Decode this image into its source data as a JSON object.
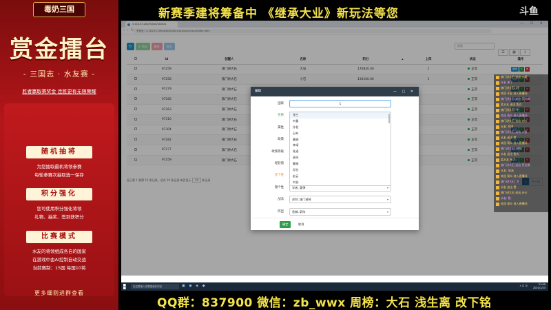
{
  "promo": {
    "tag": "毒奶三国",
    "headline": "赏金擂台",
    "subtitle": "- 三国志 · 水友赛 -",
    "slogan": "胜者赢取赛奖金  连胜更有无限荣耀",
    "sections": [
      {
        "title": "随机抽将",
        "lines": [
          "为您抽取最机将领参赛",
          "每轮参赛次抽取选一保存"
        ]
      },
      {
        "title": "积分强化",
        "lines": [
          "您可使用积分强化将领",
          "礼物、抽奖、签到获积分"
        ]
      },
      {
        "title": "比赛模式",
        "lines": [
          "水友的将领组成各自的国家",
          "在游戏中由AI控制自动交战",
          "当前赛制：15国  每国10将"
        ]
      }
    ],
    "footer": "更多细则进群查看"
  },
  "banner": {
    "text": "新赛季建将筹备中  《继承大业》新玩法等您",
    "logo": "斗鱼"
  },
  "browser": {
    "tab_title": "3.116.33.200/9x0x0/40x0x1",
    "address": "不安全 | 3.116.33.200/dxb/x0/40x1/xxx/xxxx/xxxx/index.html"
  },
  "toolbar": {
    "refresh_icon": "refresh-icon",
    "add_label": "+ 添加",
    "delete_label": "删除",
    "edit_label": "修改",
    "search_placeholder": "搜索"
  },
  "table": {
    "headers": [
      "",
      "id",
      "创建人",
      "名称",
      "积分",
      "",
      "上阵",
      "状态",
      "操作"
    ],
    "rows": [
      {
        "id": "97259",
        "creator": "旗门讲大石",
        "name": "大石",
        "score": "176820.00",
        "deploy": "1",
        "status": "正常"
      },
      {
        "id": "97258",
        "creator": "旗门讲大石",
        "name": "小石",
        "score": "134100.00",
        "deploy": "1",
        "status": "正常"
      },
      {
        "id": "97279",
        "creator": "旗门讲大石",
        "name": "",
        "score": "",
        "deploy": "",
        "status": "正常"
      },
      {
        "id": "97266",
        "creator": "旗门讲大石",
        "name": "",
        "score": "",
        "deploy": "",
        "status": "正常"
      },
      {
        "id": "97263",
        "creator": "旗门讲大石",
        "name": "",
        "score": "",
        "deploy": "",
        "status": "正常"
      },
      {
        "id": "97310",
        "creator": "旗门讲大石",
        "name": "",
        "score": "",
        "deploy": "",
        "status": "正常"
      },
      {
        "id": "97304",
        "creator": "旗门讲大石",
        "name": "",
        "score": "",
        "deploy": "",
        "status": "正常"
      },
      {
        "id": "97281",
        "creator": "旗门讲大石",
        "name": "",
        "score": "",
        "deploy": "",
        "status": "正常"
      },
      {
        "id": "97277",
        "creator": "旗门讲大石",
        "name": "",
        "score": "",
        "deploy": "",
        "status": "正常"
      },
      {
        "id": "97259",
        "creator": "旗门讲大石",
        "name": "",
        "score": "",
        "deploy": "",
        "status": "正常"
      }
    ],
    "op_labels": [
      "编辑",
      "✎",
      "✖"
    ]
  },
  "pager": {
    "summary": "显示第 1 到第 10 条记录，总共 10 条记录 每页显示",
    "page_size": "10",
    "suffix": "条记录",
    "prev": "上一页",
    "current": "1",
    "next": "下一页"
  },
  "modal": {
    "title": "编辑",
    "fields": [
      {
        "label": "国家",
        "value": "1",
        "style": "",
        "kind": "input"
      },
      {
        "label": "名称",
        "value": "",
        "style": "green",
        "kind": "none"
      },
      {
        "label": "属性",
        "value": "",
        "style": "",
        "kind": "none"
      },
      {
        "label": "政策",
        "value": "",
        "style": "",
        "kind": "none"
      },
      {
        "label": "政策等级",
        "value": "",
        "style": "",
        "kind": "none"
      },
      {
        "label": "经验值",
        "value": "",
        "style": "",
        "kind": "none"
      },
      {
        "label": "金个性",
        "value": "",
        "style": "orange",
        "kind": "none"
      },
      {
        "label": "银个性",
        "value": "学者, 重弹",
        "style": "",
        "kind": "select"
      },
      {
        "label": "战法",
        "value": "虎狩, 旗门城琴",
        "style": "",
        "kind": "select"
      },
      {
        "label": "阵型",
        "value": "鱼鳞, 箭阵",
        "style": "",
        "kind": "select"
      }
    ],
    "dropdown_options": [
      "张三",
      "刘备",
      "孙权",
      "吕布",
      "曹操",
      "李靖",
      "陆逊",
      "袁绍",
      "曹操",
      "邓艾",
      "赵云",
      "刘协"
    ],
    "ok_label": "确定",
    "cancel_label": "取消"
  },
  "chat": {
    "lines": [
      "旗门讲大石 送出 火箭",
      "水友 来了",
      "旗门讲大石: 好",
      "欢迎 水友 进入直播间",
      "旗门讲大石 送出 荧光棒",
      "某水友 送出 鱼丸",
      "旗门讲大石: 牛",
      "欢迎 观众 进入直播间",
      "旗门讲大石 送出 办卡",
      "水友: 666",
      "旗门讲大石 送出 火箭",
      "水友 送出 赞",
      "欢迎 观众 进入直播间",
      "旗门讲大石: 哈哈",
      "水友 送出 鱼丸",
      "某水友 来了",
      "旗门讲大石 送出 荧光棒",
      "水友: 加油",
      "欢迎 观众 进入直播间",
      "旗门讲大石: 冲",
      "水友 送出 赞",
      "旗门讲大石 送出 办卡",
      "水友: 稳",
      "欢迎 观众 进入直播间"
    ]
  },
  "taskbar": {
    "search_placeholder": "在这里输入你要搜索的内容",
    "tray": "∧ 口 中",
    "time": "21:09",
    "date": "2021/1/23"
  },
  "bottom": {
    "text": "QQ群：837900  微信：zb_wwx    周榜：大石 浅生离  改下铭"
  }
}
